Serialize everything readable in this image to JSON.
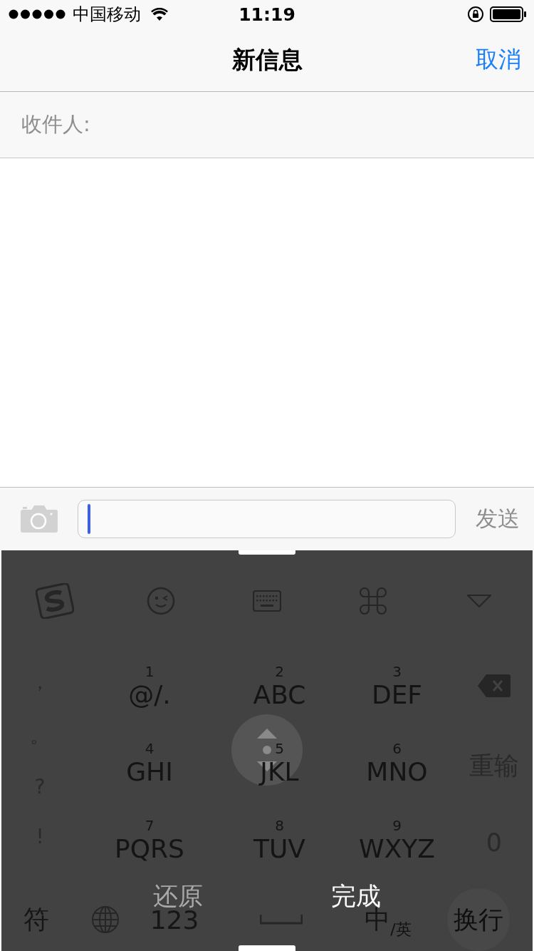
{
  "status_bar": {
    "carrier": "中国移动",
    "time": "11:19"
  },
  "nav": {
    "title": "新信息",
    "cancel": "取消"
  },
  "recipient": {
    "label": "收件人:"
  },
  "composer": {
    "send": "发送"
  },
  "keyboard": {
    "punctuation": [
      "，",
      "。",
      "?",
      "!"
    ],
    "keys": [
      {
        "number": "1",
        "letters": "@/."
      },
      {
        "number": "2",
        "letters": "ABC"
      },
      {
        "number": "3",
        "letters": "DEF"
      },
      {
        "number": "4",
        "letters": "GHI"
      },
      {
        "number": "5",
        "letters": "JKL"
      },
      {
        "number": "6",
        "letters": "MNO"
      },
      {
        "number": "7",
        "letters": "PQRS"
      },
      {
        "number": "8",
        "letters": "TUV"
      },
      {
        "number": "9",
        "letters": "WXYZ"
      }
    ],
    "reenter": "重输",
    "zero": "0",
    "symbols": "符",
    "numbers": "123",
    "lang_main": "中",
    "lang_sub": "/英",
    "newline": "换行"
  },
  "overlay": {
    "restore": "还原",
    "done": "完成"
  }
}
